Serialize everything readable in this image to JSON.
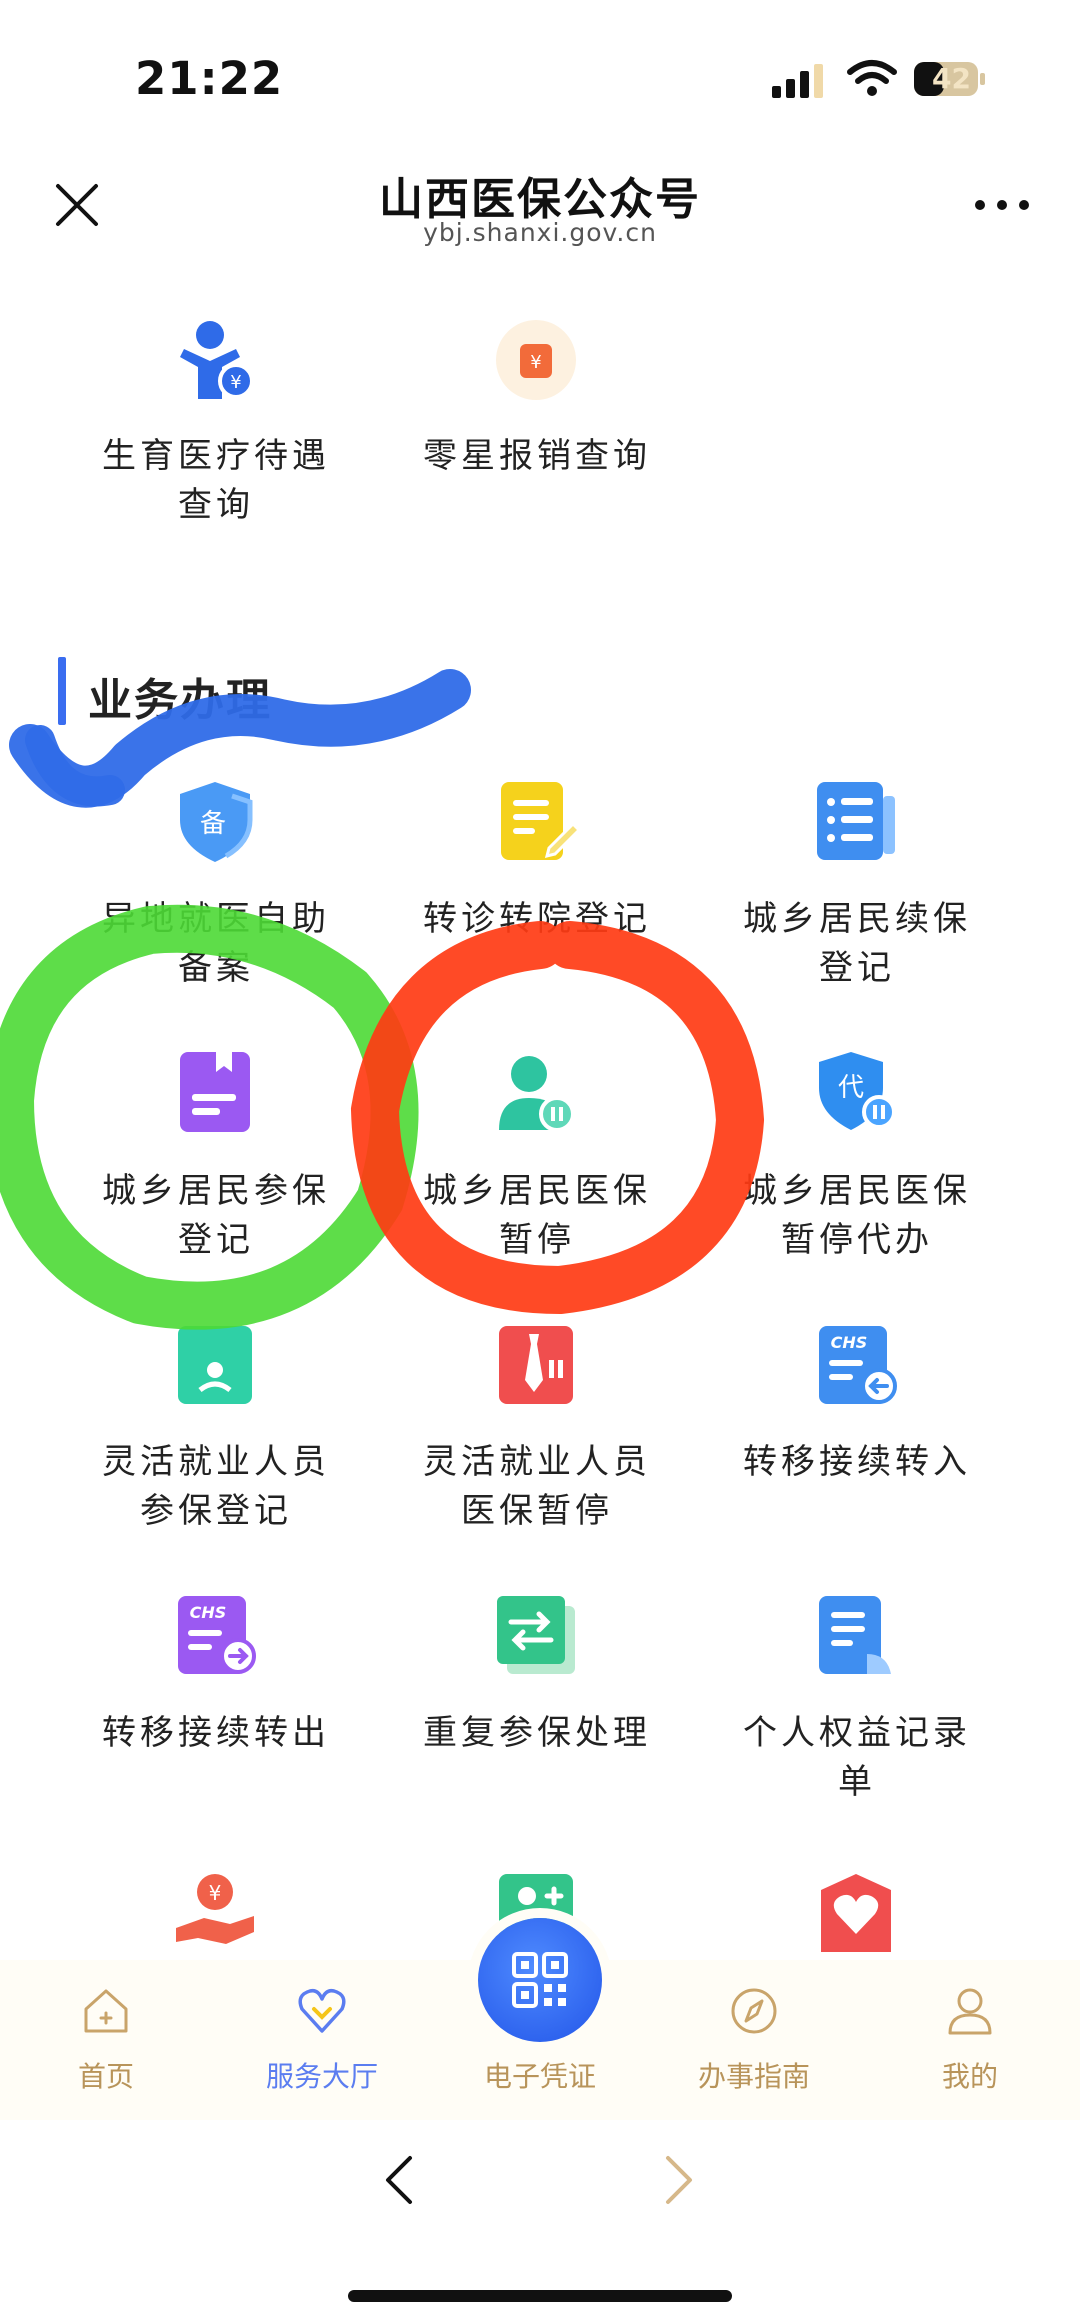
{
  "status_bar": {
    "time": "21:22",
    "battery": "42"
  },
  "header": {
    "title": "山西医保公众号",
    "url": "ybj.shanxi.gov.cn",
    "close_icon": "close-icon",
    "more_icon": "more-icon"
  },
  "top_items": [
    {
      "label_1": "生育医疗待遇",
      "label_2": "查询",
      "icon": "maternity-icon",
      "color": "#2f6be8"
    },
    {
      "label_1": "零星报销查询",
      "label_2": "",
      "icon": "reimbursement-icon",
      "color": "#f26b3a"
    }
  ],
  "section": {
    "title": "业务办理",
    "accent": "#3a6df0"
  },
  "services": [
    {
      "label_1": "异地就医自助",
      "label_2": "备案",
      "icon": "shield-icon"
    },
    {
      "label_1": "转诊转院登记",
      "label_2": "",
      "icon": "edit-note-icon"
    },
    {
      "label_1": "城乡居民续保",
      "label_2": "登记",
      "icon": "list-doc-icon"
    },
    {
      "label_1": "城乡居民参保",
      "label_2": "登记",
      "icon": "book-icon"
    },
    {
      "label_1": "城乡居民医保",
      "label_2": "暂停",
      "icon": "user-pause-icon"
    },
    {
      "label_1": "城乡居民医保",
      "label_2": "暂停代办",
      "icon": "shield-pause-icon"
    },
    {
      "label_1": "灵活就业人员",
      "label_2": "参保登记",
      "icon": "id-card-icon"
    },
    {
      "label_1": "灵活就业人员",
      "label_2": "医保暂停",
      "icon": "tie-pause-icon"
    },
    {
      "label_1": "转移接续转入",
      "label_2": "",
      "icon": "chs-in-icon"
    },
    {
      "label_1": "转移接续转出",
      "label_2": "",
      "icon": "chs-out-icon"
    },
    {
      "label_1": "重复参保处理",
      "label_2": "",
      "icon": "repeat-icon"
    },
    {
      "label_1": "个人权益记录",
      "label_2": "单",
      "icon": "record-doc-icon"
    }
  ],
  "tabbar": {
    "items": [
      {
        "label": "首页",
        "icon": "home-icon"
      },
      {
        "label": "服务大厅",
        "icon": "heart-icon"
      },
      {
        "label": "电子凭证",
        "icon": "qr-code-icon"
      },
      {
        "label": "办事指南",
        "icon": "compass-icon"
      },
      {
        "label": "我的",
        "icon": "person-icon"
      }
    ],
    "active_index": 1
  },
  "colors": {
    "tab_inactive": "#b8945a",
    "tab_active": "#5b7df0",
    "scribble_blue": "#2f6be8",
    "scribble_green": "#4cd935",
    "scribble_red": "#ff3b14"
  }
}
